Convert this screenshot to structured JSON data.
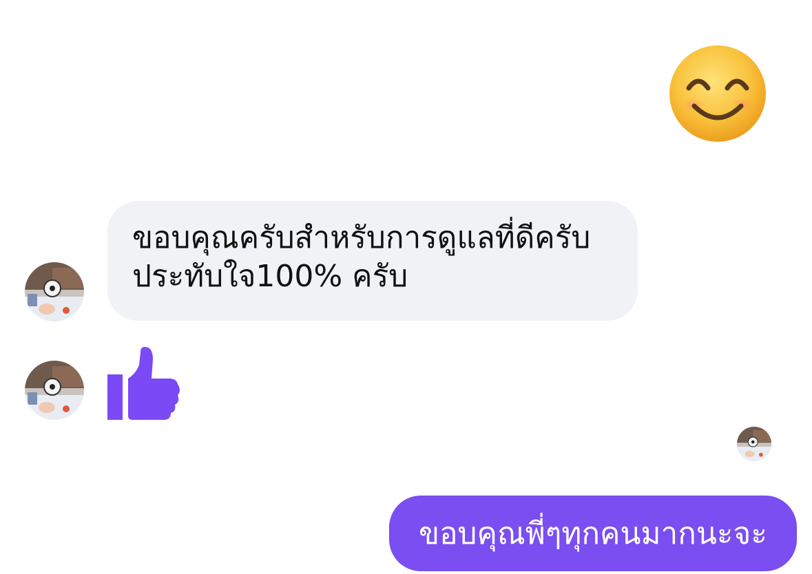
{
  "colors": {
    "incoming_bubble": "#f1f2f6",
    "outgoing_bubble": "#7a4ef0",
    "thumb": "#7b49f5",
    "emoji": "#f7b528"
  },
  "messages": [
    {
      "direction": "outgoing",
      "type": "emoji",
      "icon": "smiling-face-emoji-icon"
    },
    {
      "direction": "incoming",
      "type": "text",
      "lines": [
        "ขอบคุณครับสำหรับการดูแลที่ดีครับ",
        "ประทับใจ100% ครับ"
      ]
    },
    {
      "direction": "incoming",
      "type": "like",
      "icon": "thumbs-up-icon"
    },
    {
      "direction": "outgoing",
      "type": "text",
      "text": "ขอบคุณพี่ๆทุกคนมากนะจะ"
    }
  ]
}
